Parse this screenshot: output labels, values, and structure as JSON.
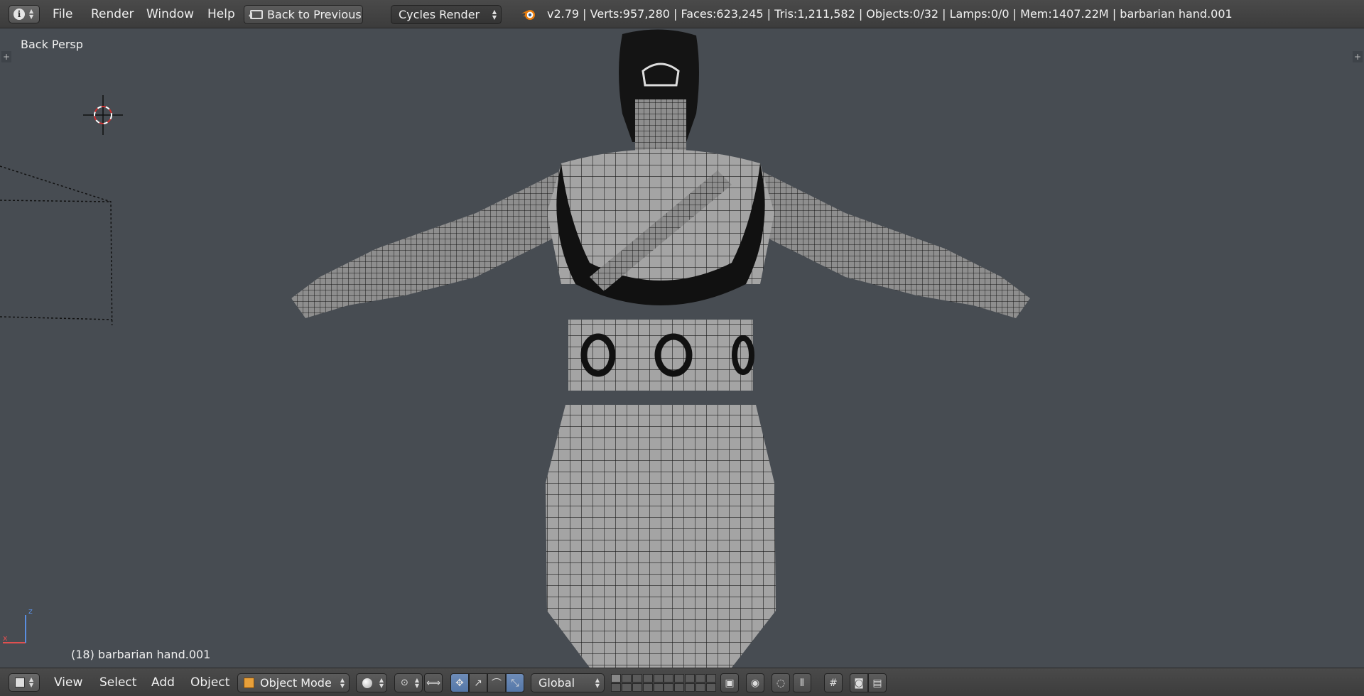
{
  "info_header": {
    "editor_type_icon": "info-icon",
    "menus": {
      "file": "File",
      "render": "Render",
      "window": "Window",
      "help": "Help"
    },
    "back_button": "Back to Previous",
    "render_engine": "Cycles Render",
    "logo_icon": "blender-logo-icon",
    "stats": "v2.79 | Verts:957,280 | Faces:623,245 | Tris:1,211,582 | Objects:0/32 | Lamps:0/0 | Mem:1407.22M | barbarian hand.001"
  },
  "viewport": {
    "view_label": "Back Persp",
    "object_label": "(18) barbarian hand.001",
    "axis_labels": {
      "x": "x",
      "z": "z"
    },
    "colors": {
      "background": "#474c52",
      "mesh_fill": "#9a9a9a",
      "wire": "#111111",
      "axis_x": "#e05050",
      "axis_z": "#5a8ee0"
    }
  },
  "view3d_header": {
    "editor_type_icon": "cube-icon",
    "menus": {
      "view": "View",
      "select": "Select",
      "add": "Add",
      "object": "Object"
    },
    "mode": "Object Mode",
    "viewport_shading_icon": "solid-sphere-icon",
    "pivot_icon": "pivot-point-icon",
    "transform_orientation": "Global",
    "icons": [
      "manipulator-icon",
      "translate-icon",
      "rotate-icon",
      "scale-icon",
      "layers-icon",
      "lock-layers-icon",
      "render-preview-icon",
      "snap-icon",
      "proportional-edit-icon",
      "copy-icon",
      "render-image-icon",
      "render-anim-icon"
    ]
  }
}
